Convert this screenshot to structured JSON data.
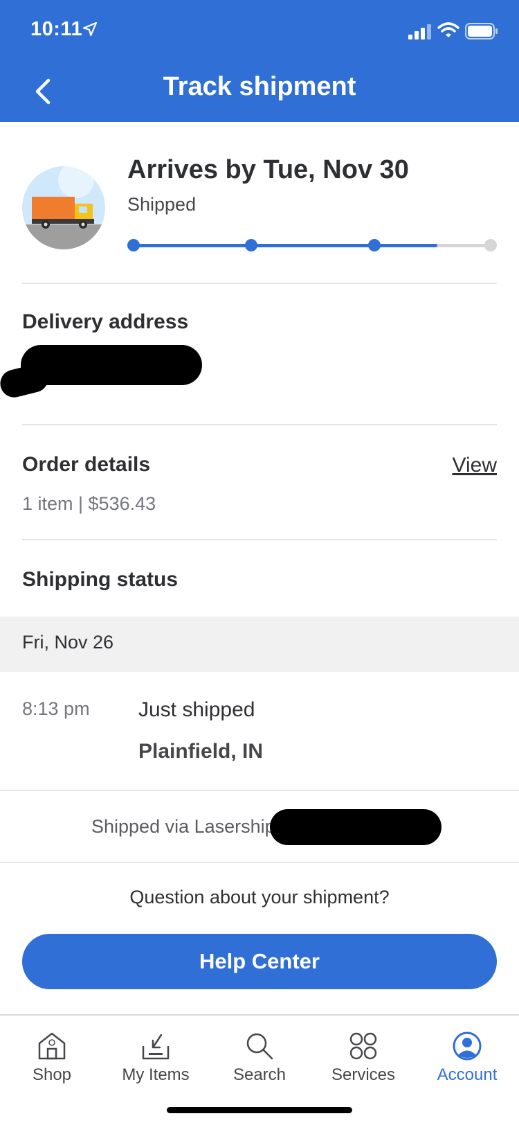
{
  "status_bar": {
    "time": "10:11"
  },
  "header": {
    "title": "Track shipment"
  },
  "arrival": {
    "title": "Arrives by Tue, Nov 30",
    "status": "Shipped",
    "progress": {
      "steps": 4,
      "completed_steps": 3,
      "fraction": 0.85
    }
  },
  "delivery": {
    "title": "Delivery address"
  },
  "order": {
    "title": "Order details",
    "view_label": "View",
    "summary": "1 item | $536.43"
  },
  "shipping": {
    "title": "Shipping status",
    "date": "Fri, Nov 26",
    "events": [
      {
        "time": "8:13 pm",
        "description": "Just shipped",
        "location": "Plainfield, IN"
      }
    ],
    "carrier_text": "Shipped via Lasership"
  },
  "help": {
    "question": "Question about your shipment?",
    "button_label": "Help Center"
  },
  "tabs": [
    {
      "label": "Shop",
      "icon": "shop-icon"
    },
    {
      "label": "My Items",
      "icon": "my-items-icon"
    },
    {
      "label": "Search",
      "icon": "search-icon"
    },
    {
      "label": "Services",
      "icon": "services-icon"
    },
    {
      "label": "Account",
      "icon": "account-icon",
      "active": true
    }
  ],
  "colors": {
    "brand_blue": "#2f6fd6",
    "progress_pending": "#d6d6d6",
    "band_gray": "#f1f1f2"
  }
}
